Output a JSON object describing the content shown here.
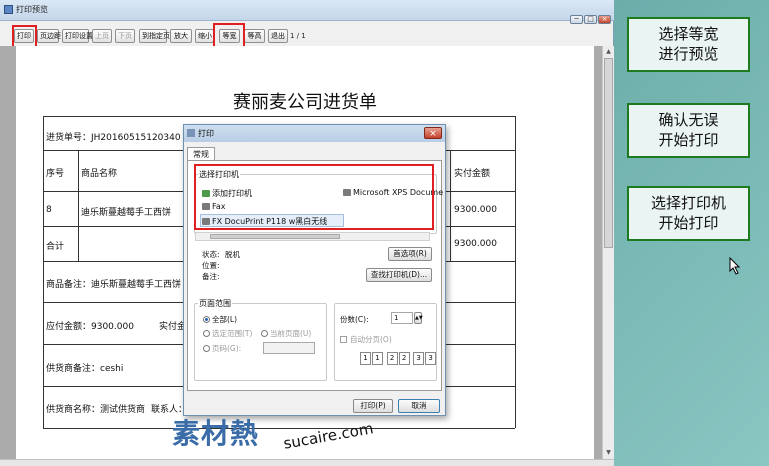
{
  "window": {
    "title": "打印预览",
    "min_label": "─",
    "max_label": "□",
    "close_label": "×"
  },
  "toolbar": {
    "buttons": [
      {
        "label": "打印",
        "enabled": true
      },
      {
        "label": "页边距",
        "enabled": true
      },
      {
        "label": "打印设置",
        "enabled": true
      },
      {
        "label": "上页",
        "enabled": false
      },
      {
        "label": "下页",
        "enabled": false
      },
      {
        "label": "到指定页",
        "enabled": true
      },
      {
        "label": "放大",
        "enabled": true
      },
      {
        "label": "缩小",
        "enabled": true
      },
      {
        "label": "等宽",
        "enabled": true
      },
      {
        "label": "等高",
        "enabled": true
      },
      {
        "label": "退出",
        "enabled": true
      }
    ],
    "page_info": "1 / 1"
  },
  "document": {
    "title": "赛丽麦公司进货单",
    "order_no": "进货单号：JH20160515120340",
    "col_seq": "序号",
    "col_name": "商品名称",
    "col_amount": "实付金额",
    "row_seq": "8",
    "row_name": "迪乐斯蔓越莓手工西饼",
    "row_amount": "9300.000",
    "total_label": "合计",
    "total_amount": "9300.000",
    "goods_note": "商品备注：迪乐斯蔓越莓手工西饼",
    "payable": "应付金额：9300.000",
    "paid": "实付金",
    "supplier_note": "供货商备注：ceshi",
    "supplier_name": "供货商名称：测试供货商",
    "contact": "联系人："
  },
  "print_dialog": {
    "title": "打印",
    "close_label": "×",
    "tab": "常规",
    "select_printer_label": "选择打印机",
    "printers": [
      {
        "name": "添加打印机",
        "icon": "add-printer-icon"
      },
      {
        "name": "Microsoft XPS Docume",
        "icon": "printer-icon"
      },
      {
        "name": "Fax",
        "icon": "fax-icon"
      },
      {
        "name": "FX DocuPrint P118 w黑白无线",
        "icon": "printer-icon"
      }
    ],
    "status_label": "状态:",
    "status_value": "脱机",
    "location_label": "位置:",
    "comment_label": "备注:",
    "preferences_button": "首选项(R)",
    "find_printer_button": "查找打印机(D)...",
    "page_range_label": "页面范围",
    "range_all": "全部(L)",
    "range_selection": "选定范围(T)",
    "range_current": "当前页面(U)",
    "range_pages": "页码(G):",
    "copies_label": "份数(C):",
    "copies_value": "1",
    "collate_label": "自动分页(O)",
    "collate_pages": [
      "1",
      "1",
      "2",
      "2",
      "3",
      "3"
    ],
    "print_button": "打印(P)",
    "cancel_button": "取消"
  },
  "notes": [
    {
      "line1": "选择等宽",
      "line2": "进行预览"
    },
    {
      "line1": "确认无误",
      "line2": "开始打印"
    },
    {
      "line1": "选择打印机",
      "line2": "开始打印"
    }
  ],
  "watermark": {
    "cn": "素材熱",
    "en": "sucaire.com"
  },
  "colors": {
    "highlight": "#e02020",
    "note_border": "#1e7a1e",
    "desktop": "#5c9c9a"
  }
}
